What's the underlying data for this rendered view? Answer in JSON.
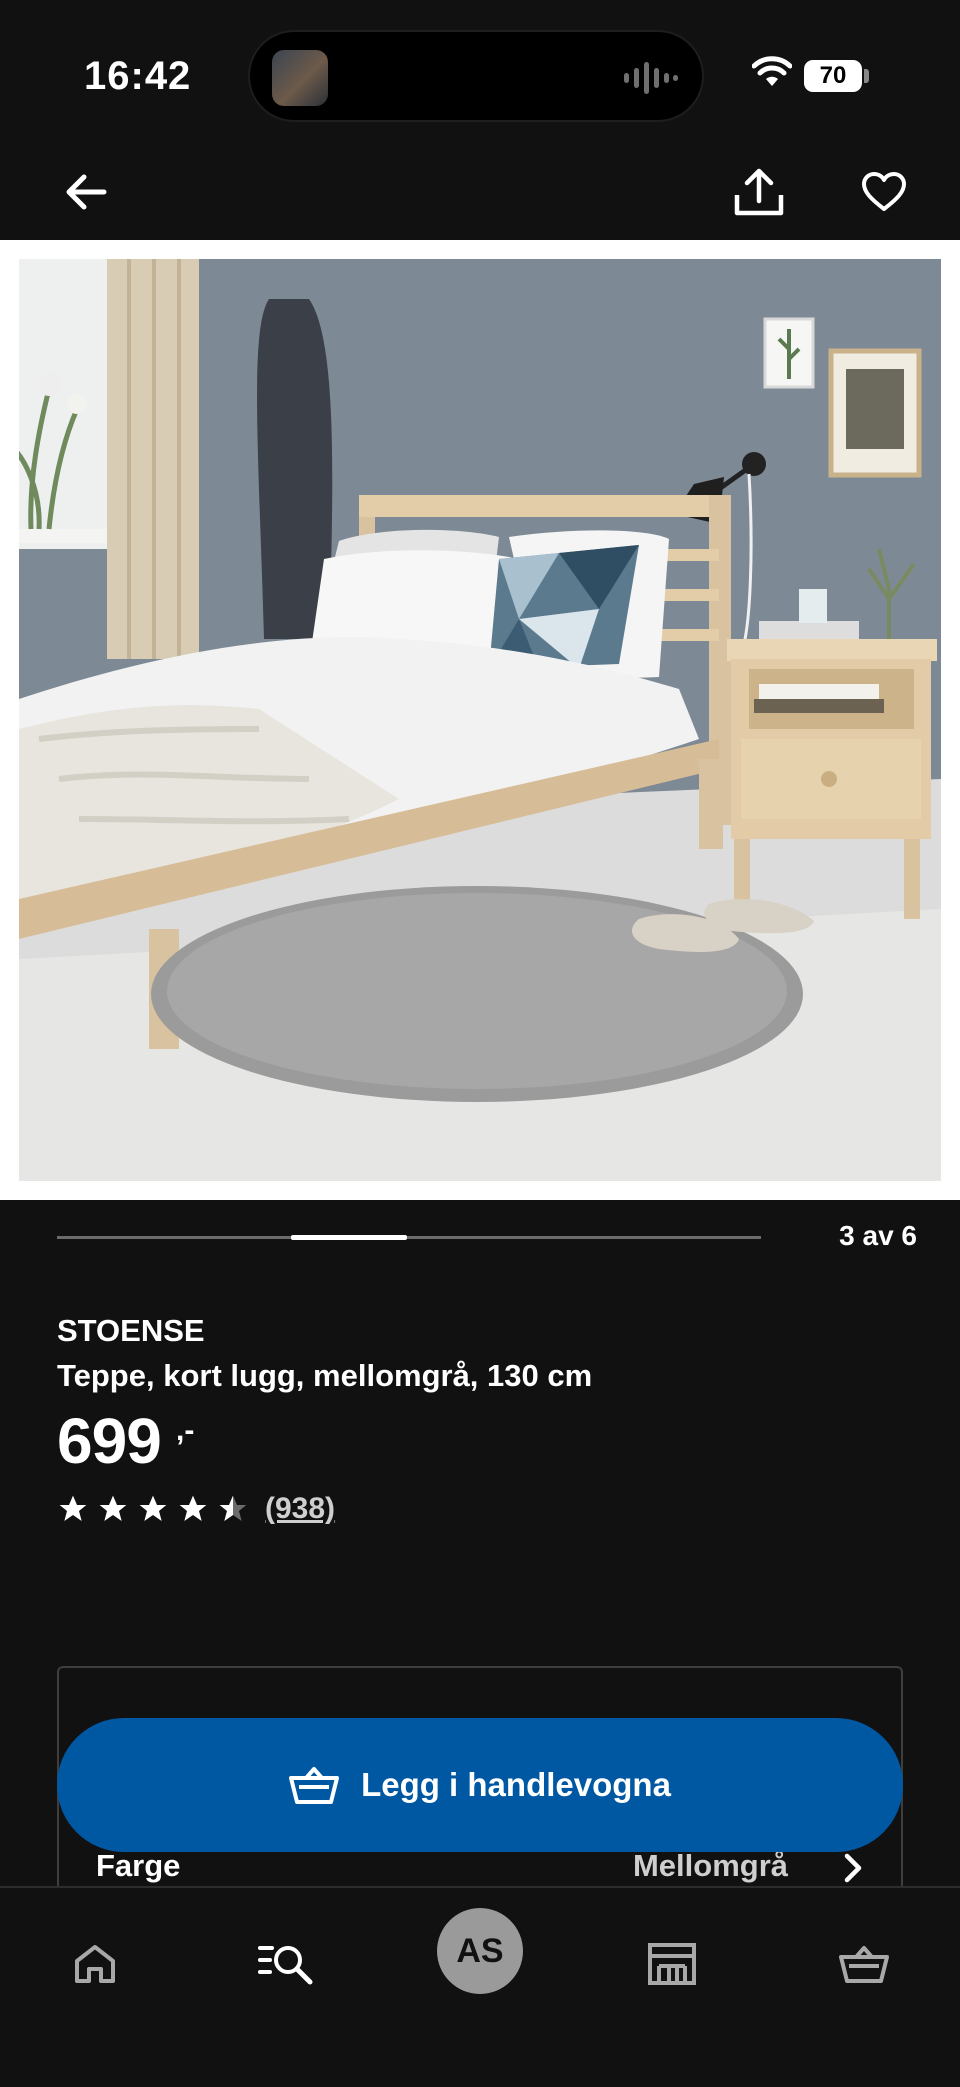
{
  "status_bar": {
    "time": "16:42",
    "battery": "70"
  },
  "product": {
    "name": "STOENSE",
    "description": "Teppe, kort lugg, mellomgrå, 130 cm",
    "price": "699",
    "price_suffix": ",-",
    "rating": 4.5,
    "review_count": "(938)"
  },
  "carousel": {
    "counter": "3 av 6",
    "current": 3,
    "total": 6
  },
  "actions": {
    "add_to_cart": "Legg i handlevogna"
  },
  "color_option": {
    "label": "Farge",
    "value": "Mellomgrå"
  },
  "bottom_nav": {
    "avatar_initials": "AS",
    "items": [
      "home-icon",
      "search-list-icon",
      "avatar",
      "store-icon",
      "cart-icon"
    ]
  },
  "colors": {
    "background": "#111111",
    "accent_blue": "#0058a3",
    "text": "#ffffff"
  }
}
